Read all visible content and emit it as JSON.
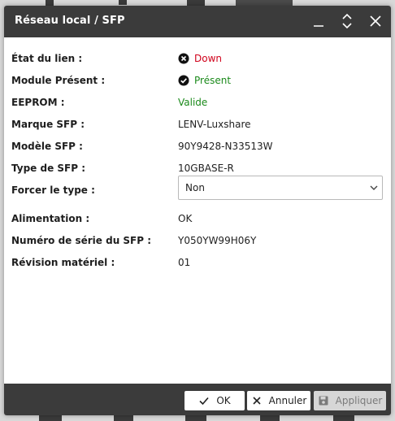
{
  "dialog": {
    "title": "Réseau local / SFP"
  },
  "fields": {
    "link_state": {
      "label": "État du lien :",
      "value": "Down",
      "status_color": "#d0021b",
      "icon": "x-circle-icon"
    },
    "module_present": {
      "label": "Module Présent :",
      "value": "Présent",
      "status_color": "#1b8a1b",
      "icon": "check-circle-icon"
    },
    "eeprom": {
      "label": "EEPROM :",
      "value": "Valide",
      "status_color": "#1b8a1b"
    },
    "brand": {
      "label": "Marque SFP :",
      "value": "LENV-Luxshare"
    },
    "model": {
      "label": "Modèle SFP :",
      "value": "90Y9428-N33513W"
    },
    "sfp_type": {
      "label": "Type de SFP :",
      "value": "10GBASE-R"
    },
    "force_type": {
      "label": "Forcer le type :",
      "value": "Non"
    },
    "power": {
      "label": "Alimentation :",
      "value": "OK"
    },
    "serial": {
      "label": "Numéro de série du SFP :",
      "value": "Y050YW99H06Y"
    },
    "revision": {
      "label": "Révision matériel :",
      "value": "01"
    }
  },
  "footer": {
    "ok_label": "OK",
    "cancel_label": "Annuler",
    "apply_label": "Appliquer"
  },
  "colors": {
    "titlebar": "#3b3b3b",
    "error": "#d0021b",
    "success": "#1b8a1b"
  }
}
